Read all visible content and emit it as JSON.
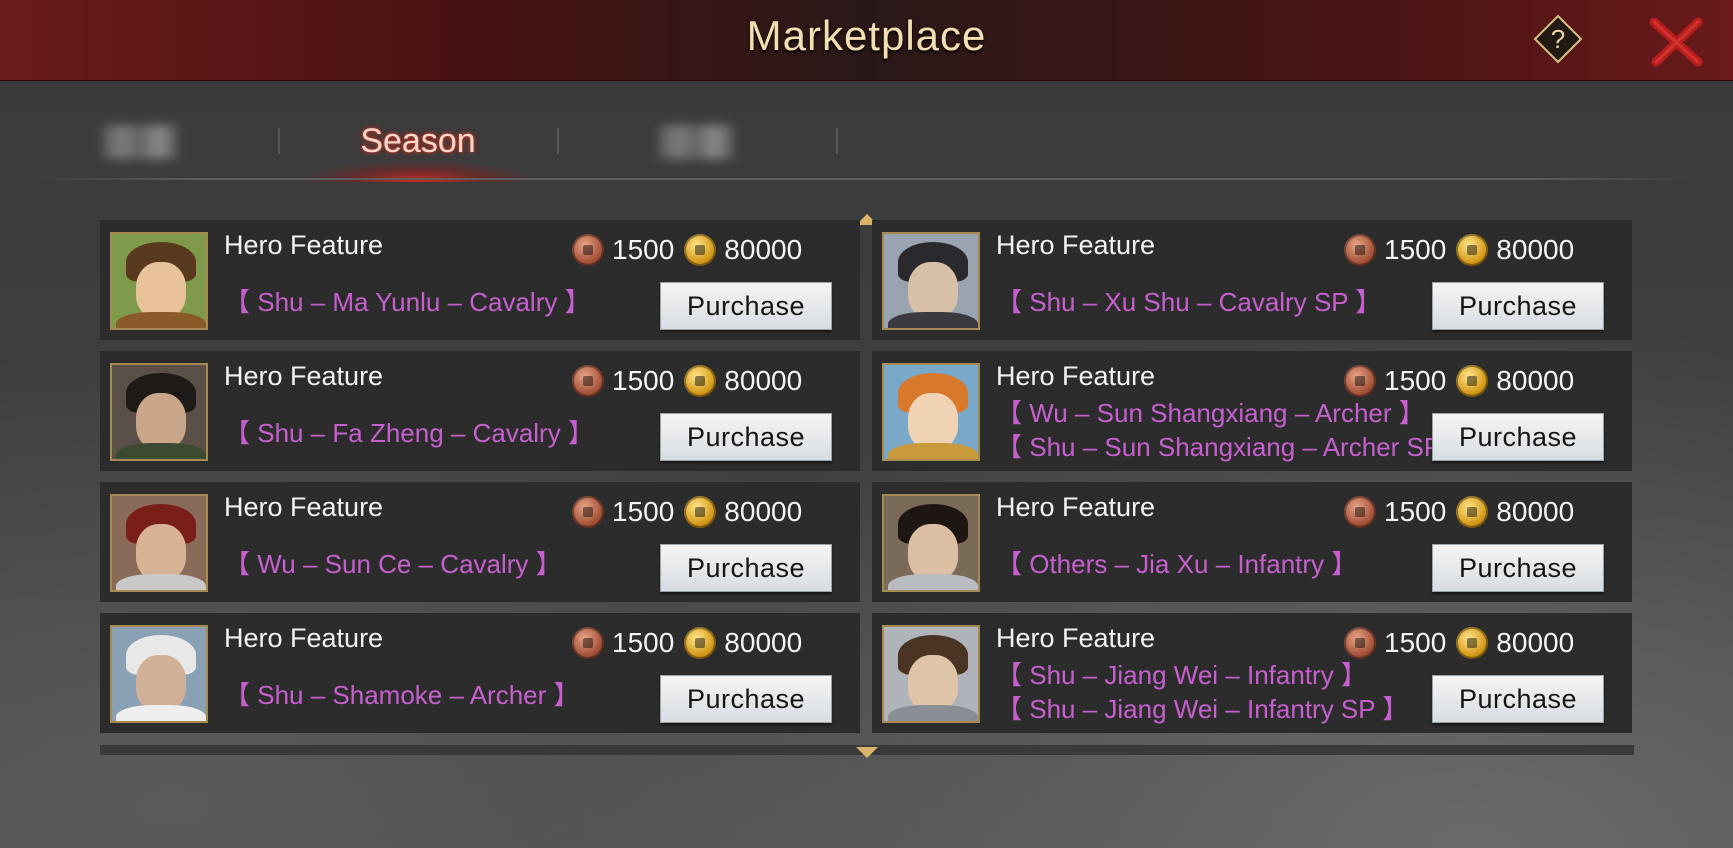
{
  "window": {
    "title": "Marketplace"
  },
  "tabs": {
    "active_label": "Season"
  },
  "cost": {
    "bronze": "1500",
    "gold": "80000"
  },
  "purchase_label": "Purchase",
  "feature_label": "Hero Feature",
  "offers": [
    {
      "heroes": [
        "【 Shu – Ma Yunlu – Cavalry 】"
      ]
    },
    {
      "heroes": [
        "【 Shu – Xu Shu – Cavalry SP 】"
      ]
    },
    {
      "heroes": [
        "【 Shu – Fa Zheng – Cavalry 】"
      ]
    },
    {
      "heroes": [
        "【 Wu – Sun Shangxiang – Archer 】",
        "【 Shu – Sun Shangxiang – Archer SP 】"
      ]
    },
    {
      "heroes": [
        "【 Wu – Sun Ce – Cavalry 】"
      ]
    },
    {
      "heroes": [
        "【 Others – Jia Xu – Infantry 】"
      ]
    },
    {
      "heroes": [
        "【 Shu – Shamoke – Archer 】"
      ]
    },
    {
      "heroes": [
        "【 Shu – Jiang Wei – Infantry 】",
        "【 Shu – Jiang Wei – Infantry SP 】"
      ]
    }
  ],
  "colors": {
    "hero_name": "#c760cf",
    "title_gold": "#f3dfb2",
    "accent_red": "#c0281c"
  }
}
